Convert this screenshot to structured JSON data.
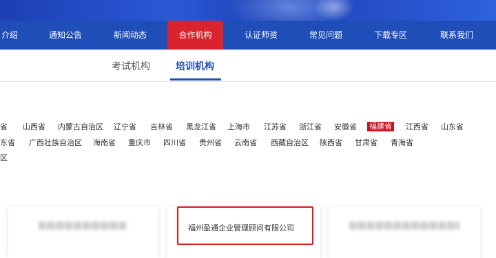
{
  "nav": {
    "items": [
      {
        "label": "介绍"
      },
      {
        "label": "通知公告"
      },
      {
        "label": "新闻动态"
      },
      {
        "label": "合作机构",
        "active": true
      },
      {
        "label": "认证师资"
      },
      {
        "label": "常见问题"
      },
      {
        "label": "下载专区"
      },
      {
        "label": "联系我们"
      }
    ],
    "active_color": "#d9232d",
    "bar_color": "#1f4eb8"
  },
  "subtabs": {
    "exam": "考试机构",
    "training": "培训机构",
    "active": "培训机构"
  },
  "provinces": {
    "row1": [
      "省",
      "山西省",
      "内蒙古自治区",
      "辽宁省",
      "吉林省",
      "黑龙江省",
      "上海市",
      "江苏省",
      "浙江省",
      "安徽省",
      "福建省",
      "江西省",
      "山东省"
    ],
    "row2": [
      "东省",
      "广西壮族自治区",
      "海南省",
      "重庆市",
      "四川省",
      "贵州省",
      "云南省",
      "西藏自治区",
      "陕西省",
      "甘肃省",
      "青海省"
    ],
    "row3": [
      "区"
    ],
    "selected": "福建省",
    "selected_color": "#c4161c"
  },
  "cards": {
    "company": "福州盈通企业管理顾问有限公司"
  }
}
